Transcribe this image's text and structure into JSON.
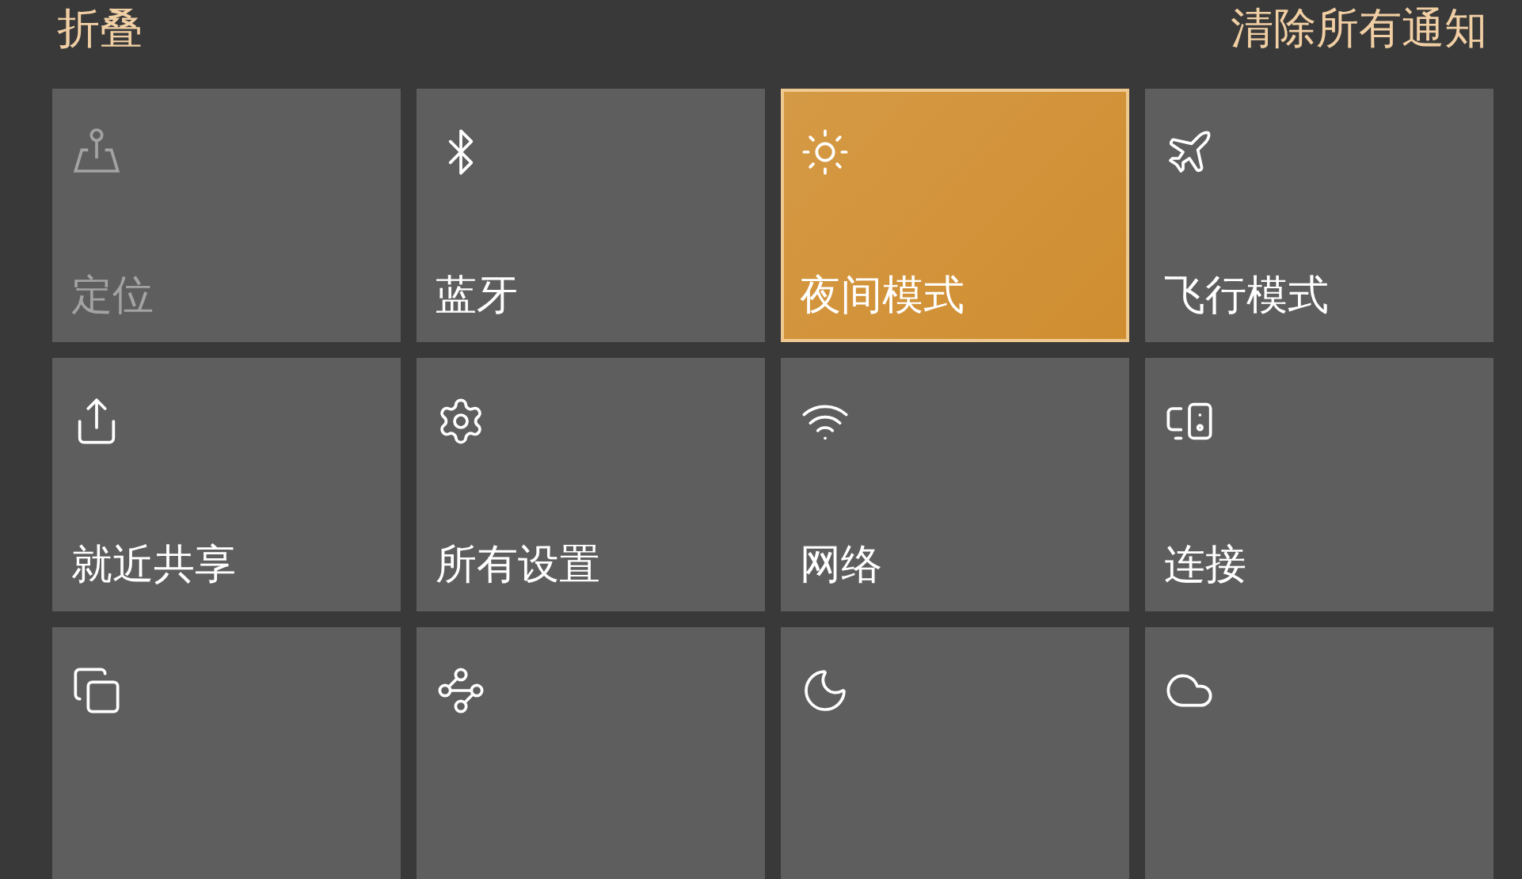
{
  "header": {
    "collapse": "折叠",
    "clear_all": "清除所有通知"
  },
  "tiles": [
    {
      "label": "定位",
      "on": false,
      "disabled": true
    },
    {
      "label": "蓝牙",
      "on": false,
      "disabled": false
    },
    {
      "label": "夜间模式",
      "on": true,
      "disabled": false
    },
    {
      "label": "飞行模式",
      "on": false,
      "disabled": false
    },
    {
      "label": "就近共享",
      "on": false,
      "disabled": false
    },
    {
      "label": "所有设置",
      "on": false,
      "disabled": false
    },
    {
      "label": "网络",
      "on": false,
      "disabled": false
    },
    {
      "label": "连接",
      "on": false,
      "disabled": false
    },
    {
      "on": false,
      "disabled": false
    },
    {
      "on": false,
      "disabled": false
    },
    {
      "on": false,
      "disabled": false
    },
    {
      "on": false,
      "disabled": false
    }
  ]
}
